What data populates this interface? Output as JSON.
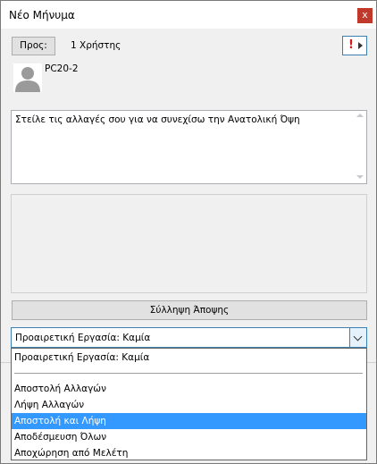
{
  "window": {
    "title": "Νέο Μήνυμα",
    "close_label": "x"
  },
  "header": {
    "to_label": "Προς:",
    "recipients_text": "1 Χρήστης",
    "priority_icon": "exclamation-icon"
  },
  "recipient": {
    "name": "PC20-2",
    "avatar_icon": "user-silhouette-icon"
  },
  "message": {
    "text": "Στείλε τις αλλαγές σου για να συνεχίσω την Ανατολική Όψη"
  },
  "capture_button": {
    "label": "Σύλληψη Άποψης"
  },
  "task_select": {
    "selected": "Προαιρετική Εργασία: Καμία",
    "options": [
      "Προαιρετική Εργασία: Καμία",
      "Αποστολή Αλλαγών",
      "Λήψη Αλλαγών",
      "Αποστολή και Λήψη",
      "Αποδέσμευση Όλων",
      "Αποχώρηση από Μελέτη"
    ],
    "highlighted_index": 3
  },
  "colors": {
    "highlight": "#3399ff",
    "close": "#c0392b",
    "focus_border": "#3c7fb1"
  }
}
